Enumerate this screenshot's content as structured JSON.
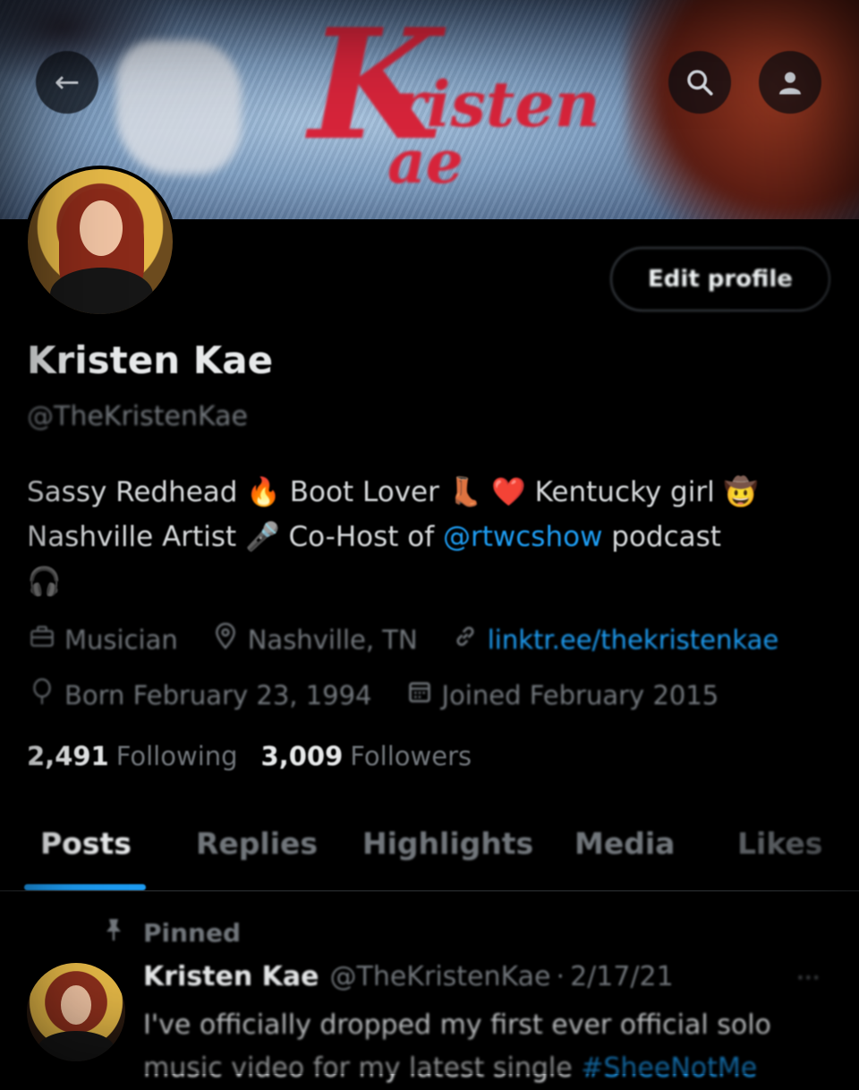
{
  "banner": {
    "script_k": "K",
    "script_line1": "risten",
    "script_line2": "ae",
    "icons": {
      "back": "arrow-left-icon",
      "search": "search-icon",
      "more": "person-icon"
    }
  },
  "profile": {
    "edit_label": "Edit profile",
    "name": "Kristen Kae",
    "handle": "@TheKristenKae",
    "bio": {
      "part1": "Sassy Redhead ",
      "part2": " Boot Lover ",
      "part3": " Kentucky girl ",
      "part4": "Nashville Artist ",
      "part5": " Co-Host of ",
      "mention": "@rtwcshow",
      "part6": " podcast",
      "emoji_fire": "🔥",
      "emoji_boot": "👢",
      "emoji_heart": "❤️",
      "emoji_cowboy": "🤠",
      "emoji_mic": "🎤",
      "emoji_headphones": "🎧"
    },
    "meta": {
      "profession": "Musician",
      "location": "Nashville, TN",
      "link": "linktr.ee/thekristenkae",
      "born": "Born February 23, 1994",
      "joined": "Joined February 2015"
    },
    "stats": {
      "following_count": "2,491",
      "following_label": "Following",
      "followers_count": "3,009",
      "followers_label": "Followers"
    }
  },
  "tabs": [
    {
      "label": "Posts",
      "active": true
    },
    {
      "label": "Replies"
    },
    {
      "label": "Highlights"
    },
    {
      "label": "Media"
    },
    {
      "label": "Likes"
    }
  ],
  "pinned_post": {
    "pinned_label": "Pinned",
    "author": "Kristen Kae",
    "handle": "@TheKristenKae",
    "separator": "·",
    "date": "2/17/21",
    "text_line1": "I've officially dropped my first ever official solo",
    "text_line2": "music video for my latest single ",
    "hashtag": "#SheeNotMe"
  },
  "colors": {
    "background": "#000000",
    "text_primary": "#e7e9ea",
    "text_secondary": "#71767b",
    "accent": "#1d9bf0"
  }
}
